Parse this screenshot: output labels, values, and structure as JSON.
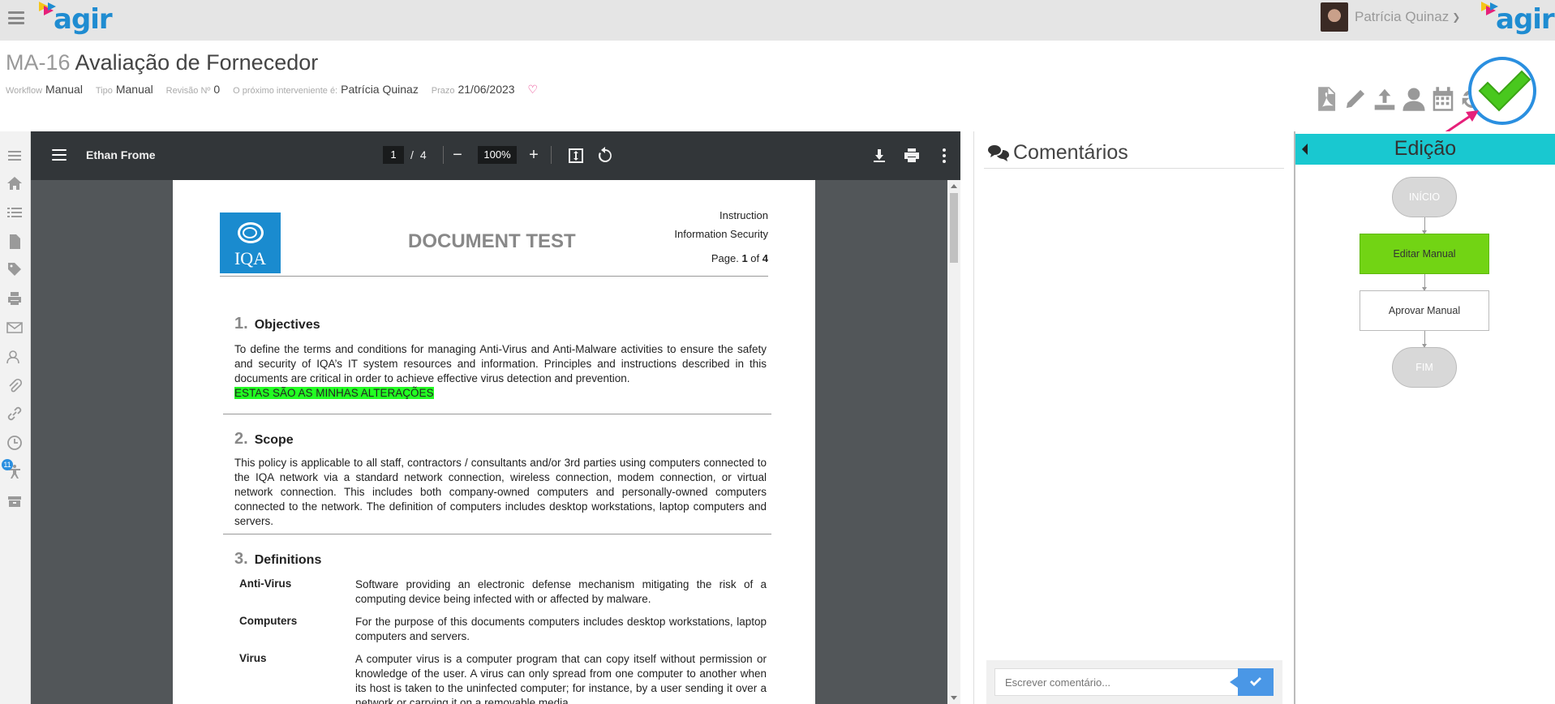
{
  "app": {
    "name": "agir",
    "colors": {
      "brand_blue": "#1f8cd1",
      "brand_pink": "#e6207a",
      "brand_yellow": "#f5c518",
      "active_step": "#72d414",
      "workflow_header": "#19c8d0"
    }
  },
  "topbar": {
    "user_name": "Patrícia Quinaz",
    "menu_icon": "hamburger-icon",
    "user_caret": "chevron-down-icon"
  },
  "header": {
    "code": "MA-16",
    "title": "Avaliação de Fornecedor",
    "meta": [
      {
        "label": "Workflow",
        "value": "Manual"
      },
      {
        "label": "Tipo",
        "value": "Manual"
      },
      {
        "label": "Revisão Nº",
        "value": "0"
      },
      {
        "label": "O próximo interveniente é:",
        "value": "Patrícia Quinaz"
      },
      {
        "label": "Prazo",
        "value": "21/06/2023"
      }
    ],
    "heart": "♡",
    "tools": [
      "pdf-icon",
      "edit-icon",
      "upload-icon",
      "user-icon",
      "calendar-icon",
      "refresh-icon"
    ],
    "approve_icon": "checkmark-icon"
  },
  "rail": [
    "menu-icon",
    "home-icon",
    "list-icon",
    "document-icon",
    "tag-icon",
    "print-icon",
    "mail-icon",
    "contacts-icon",
    "attachment-icon",
    "link-icon",
    "clock-icon",
    "accessibility-icon",
    "archive-icon"
  ],
  "rail_badge": "11",
  "pdf": {
    "file_name": "Ethan Frome",
    "page_current": "1",
    "page_sep": "/",
    "page_total": "4",
    "zoom": "100%",
    "zoom_out": "−",
    "zoom_in": "+",
    "document": {
      "logo_text": "IQA",
      "heading": "DOCUMENT TEST",
      "header_right": [
        "Instruction",
        "Information Security"
      ],
      "page_label": "Page.",
      "page_num": "1",
      "page_of": "of",
      "page_total": "4",
      "sections": [
        {
          "num": "1.",
          "title": "Objectives",
          "text": "To define the terms and conditions for managing Anti-Virus and Anti-Malware activities to ensure the safety and security of IQA’s IT system resources and information. Principles and instructions described in this documents are critical in order to achieve effective virus detection and prevention.",
          "highlight": "ESTAS SÃO AS MINHAS ALTERAÇÕES"
        },
        {
          "num": "2.",
          "title": "Scope",
          "text": "This policy is applicable to all staff, contractors / consultants and/or 3rd parties using computers connected to the IQA network via a standard network connection, wireless connection, modem connection, or virtual network connection. This includes both company-owned computers and personally-owned computers connected to the network. The definition of computers includes desktop workstations, laptop computers and servers."
        },
        {
          "num": "3.",
          "title": "Definitions"
        }
      ],
      "definitions": [
        {
          "term": "Anti-Virus",
          "text": "Software providing an electronic defense mechanism mitigating the risk of a computing device being infected with or affected by malware."
        },
        {
          "term": "Computers",
          "text": "For the purpose of this documents computers includes desktop workstations, laptop computers and servers."
        },
        {
          "term": "Virus",
          "text": "A computer virus is a computer program that can copy itself without permission or knowledge of the user. A virus can only spread from one computer to another when its host is taken to the uninfected computer; for instance, by a user sending it over a network or carrying it on a removable media."
        }
      ]
    }
  },
  "comments": {
    "title": "Comentários",
    "placeholder": "Escrever comentário..."
  },
  "workflow": {
    "title": "Edição",
    "steps": [
      {
        "label": "INÍCIO",
        "kind": "start"
      },
      {
        "label": "Editar Manual",
        "kind": "task",
        "active": true
      },
      {
        "label": "Aprovar Manual",
        "kind": "task",
        "active": false
      },
      {
        "label": "FIM",
        "kind": "end"
      }
    ]
  }
}
